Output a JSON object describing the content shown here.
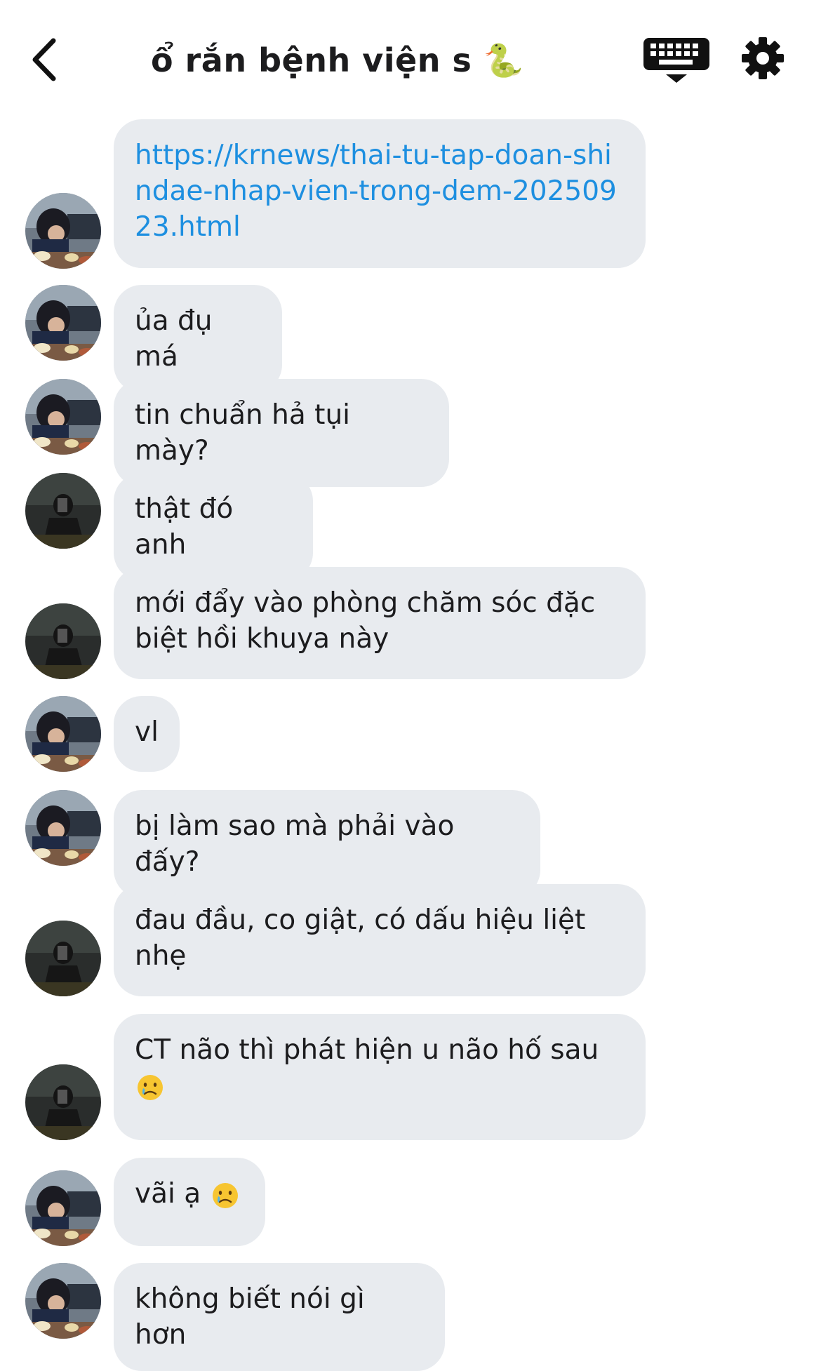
{
  "header": {
    "title": "ổ rắn bệnh viện s 🐍",
    "back_icon": "chevron-left-icon",
    "keyboard_icon": "keyboard-icon",
    "settings_icon": "gear-icon"
  },
  "colors": {
    "bubble_bg": "#e8ebef",
    "link": "#1d8fe0",
    "text": "#1c1c1e"
  },
  "messages": [
    {
      "sender": "user-a",
      "text": "https://krnews/thai-tu-tap-doan-shindae-nhap-vien-trong-dem-20250923.html",
      "is_link": true
    },
    {
      "sender": "user-a",
      "text": "ủa đụ má"
    },
    {
      "sender": "user-a",
      "text": "tin chuẩn hả tụi mày?"
    },
    {
      "sender": "user-b",
      "text": "thật đó anh"
    },
    {
      "sender": "user-b",
      "text": "mới đẩy vào phòng chăm sóc đặc biệt hồi khuya này"
    },
    {
      "sender": "user-a",
      "text": "vl"
    },
    {
      "sender": "user-a",
      "text": "bị làm sao mà phải vào đấy?"
    },
    {
      "sender": "user-b",
      "text": "đau đầu, co giật, có dấu hiệu liệt nhẹ"
    },
    {
      "sender": "user-b",
      "text": "CT não thì phát hiện u não hố sau",
      "emoji": "crying-face"
    },
    {
      "sender": "user-a",
      "text": "vãi ạ",
      "emoji": "crying-face"
    },
    {
      "sender": "user-a",
      "text": "không biết nói gì hơn"
    }
  ]
}
